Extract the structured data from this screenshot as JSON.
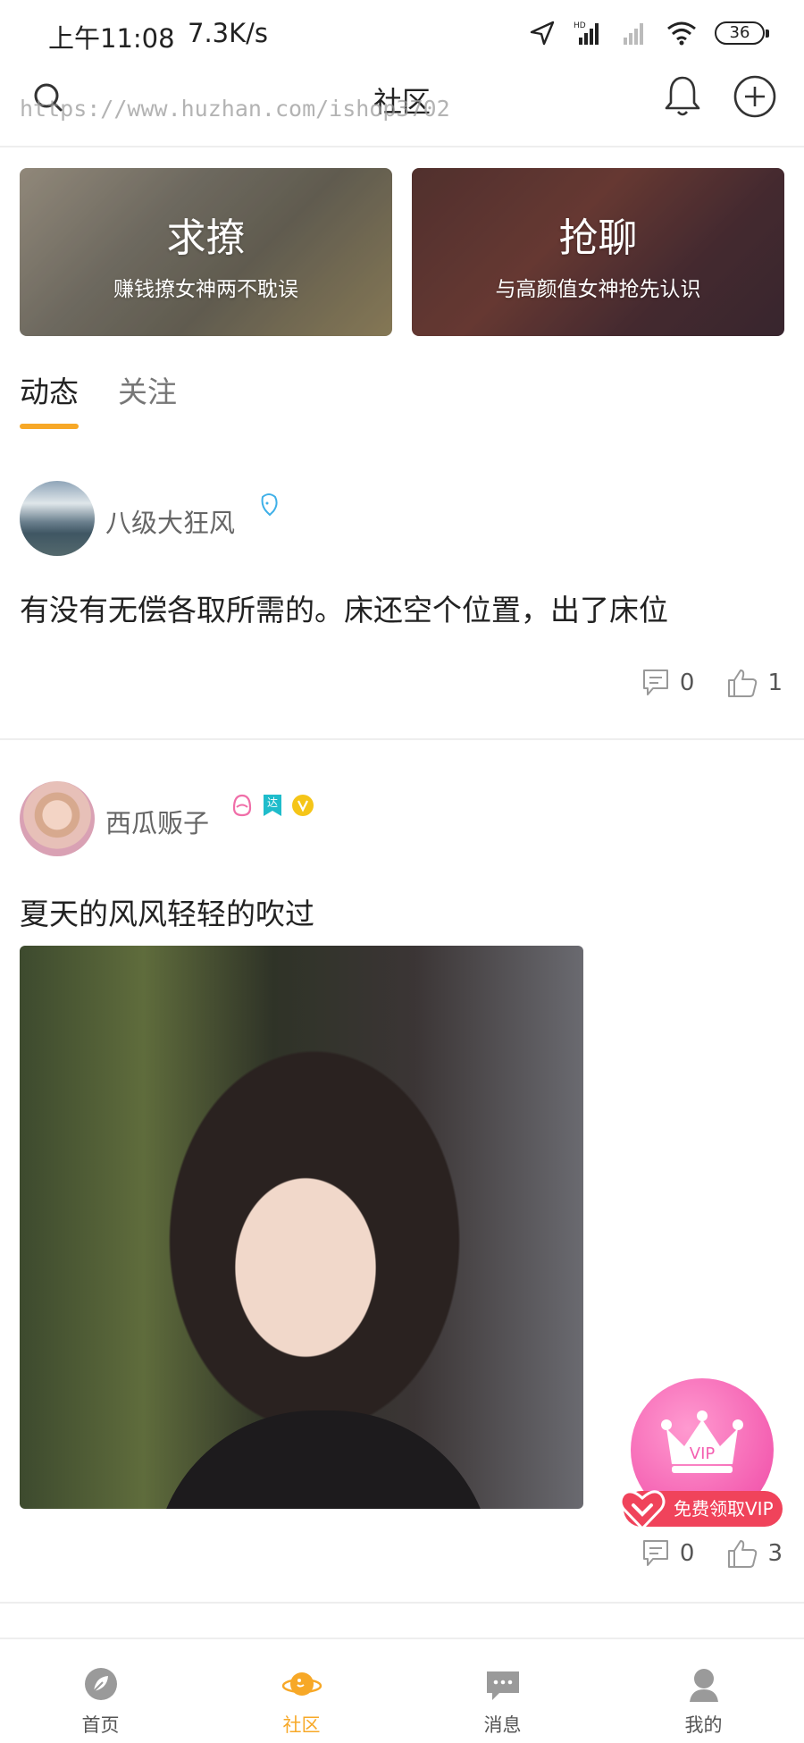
{
  "status_bar": {
    "time": "上午11:08",
    "speed": "7.3K/s",
    "battery": "36"
  },
  "header": {
    "title": "社区",
    "watermark": "https://www.huzhan.com/ishop3702"
  },
  "banners": [
    {
      "title": "求撩",
      "subtitle": "赚钱撩女神两不耽误"
    },
    {
      "title": "抢聊",
      "subtitle": "与高颜值女神抢先认识"
    }
  ],
  "tabs": [
    {
      "label": "动态",
      "active": true
    },
    {
      "label": "关注",
      "active": false
    }
  ],
  "posts": [
    {
      "username": "八级大狂风",
      "text": "有没有无偿各取所需的。床还空个位置，出了床位",
      "comments": "0",
      "likes": "1"
    },
    {
      "username": "西瓜贩子",
      "text": "夏天的风风轻轻的吹过",
      "comments": "0",
      "likes": "3",
      "badge_text": "达"
    }
  ],
  "vip": {
    "badge": "VIP",
    "label": "免费领取VIP"
  },
  "bottom_nav": [
    {
      "label": "首页"
    },
    {
      "label": "社区"
    },
    {
      "label": "消息"
    },
    {
      "label": "我的"
    }
  ],
  "colors": {
    "accent": "#f7a827",
    "vip_pink": "#f45fb1",
    "vip_red": "#f0435b"
  }
}
